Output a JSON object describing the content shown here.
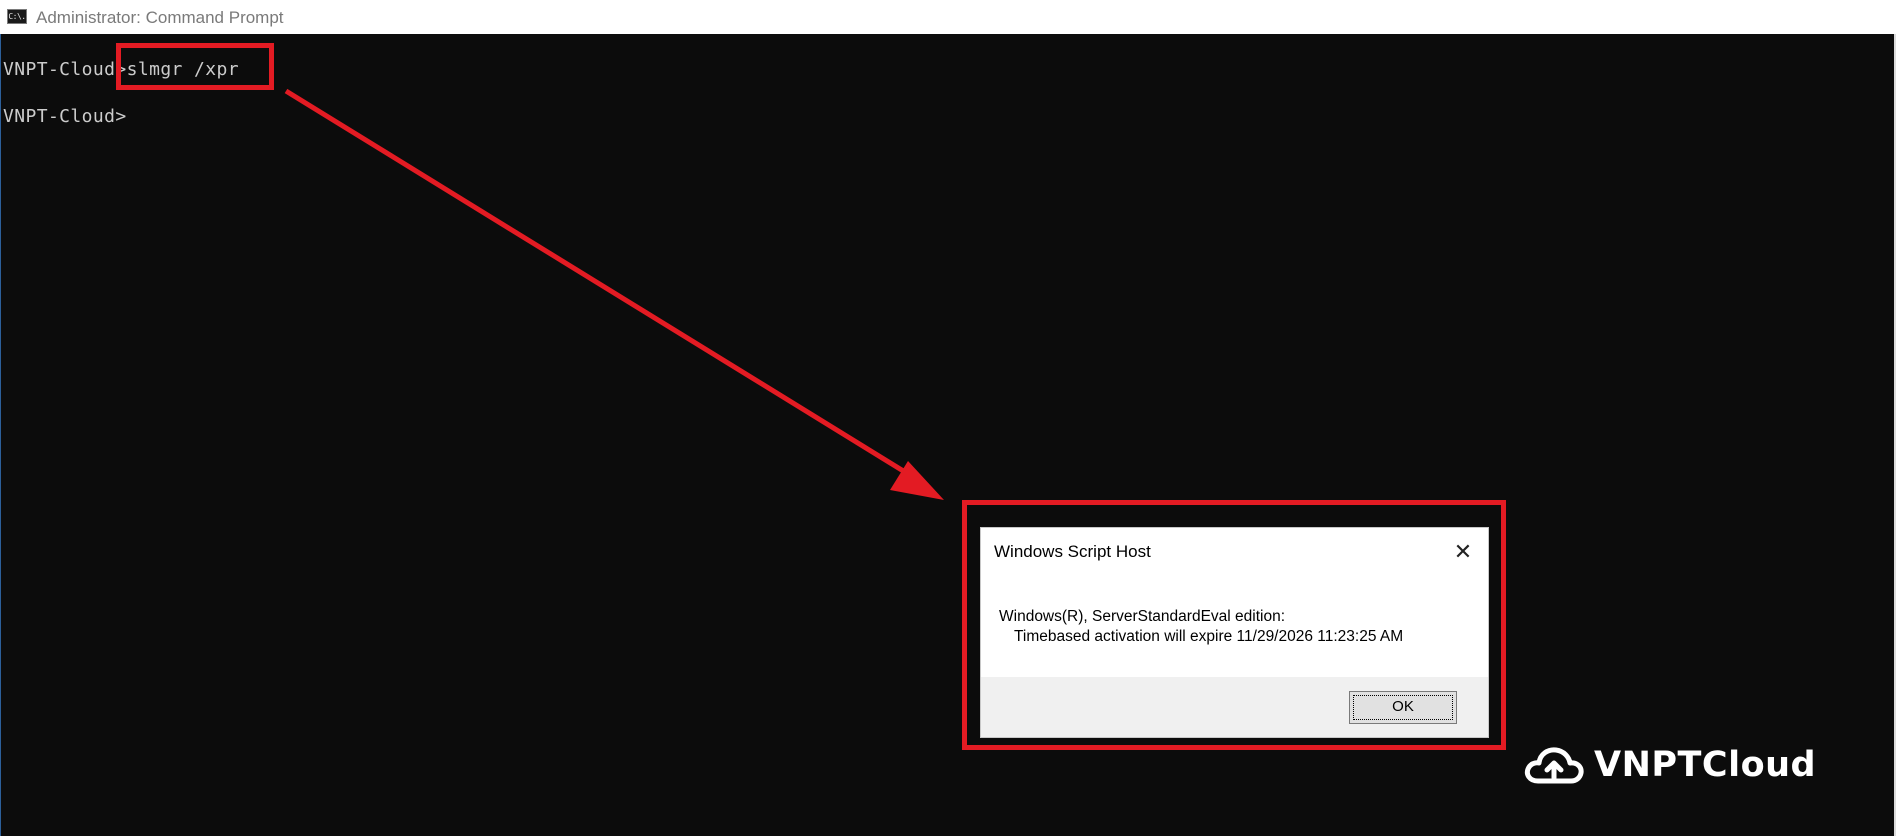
{
  "window": {
    "title": "Administrator: Command Prompt",
    "icon_text": "C:\\."
  },
  "console": {
    "line1_prompt": "VNPT-Cloud>",
    "line1_command": "slmgr /xpr",
    "line2_prompt": "VNPT-Cloud>"
  },
  "dialog": {
    "title": "Windows Script Host",
    "close_glyph": "✕",
    "message_line1": "Windows(R), ServerStandardEval edition:",
    "message_line2": "Timebased activation will expire 11/29/2026 11:23:25 AM",
    "ok_label": "OK"
  },
  "logo": {
    "text": "VNPTCloud",
    "icon": "cloud-upload-icon"
  },
  "colors": {
    "highlight": "#e31b23",
    "console_bg": "#0c0c0c",
    "console_text": "#cccccc"
  }
}
